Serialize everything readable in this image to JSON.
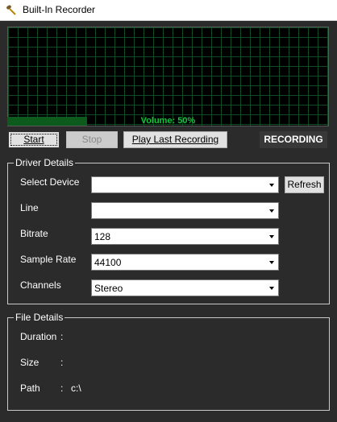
{
  "window": {
    "title": "Built-In Recorder",
    "icon": "microphone-icon"
  },
  "meter": {
    "volume_label": "Volume: 50%",
    "volume_level": 0.5,
    "grid_color": "#0f4a22",
    "text_color": "#11c63a"
  },
  "controls": {
    "start_label": "Start",
    "stop_label": "Stop",
    "play_label": "Play Last Recording",
    "status_label": "RECORDING"
  },
  "driver_details": {
    "title": "Driver Details",
    "select_device": {
      "label": "Select Device",
      "value": ""
    },
    "refresh_label": "Refresh",
    "line": {
      "label": "Line",
      "value": ""
    },
    "bitrate": {
      "label": "Bitrate",
      "value": "128"
    },
    "sample_rate": {
      "label": "Sample Rate",
      "value": "44100"
    },
    "channels": {
      "label": "Channels",
      "value": "Stereo"
    }
  },
  "file_details": {
    "title": "File Details",
    "duration": {
      "label": "Duration",
      "colon": ":",
      "value": ""
    },
    "size": {
      "label": "Size",
      "colon": ":",
      "value": ""
    },
    "path": {
      "label": "Path",
      "colon": ":",
      "value": "c:\\"
    }
  }
}
